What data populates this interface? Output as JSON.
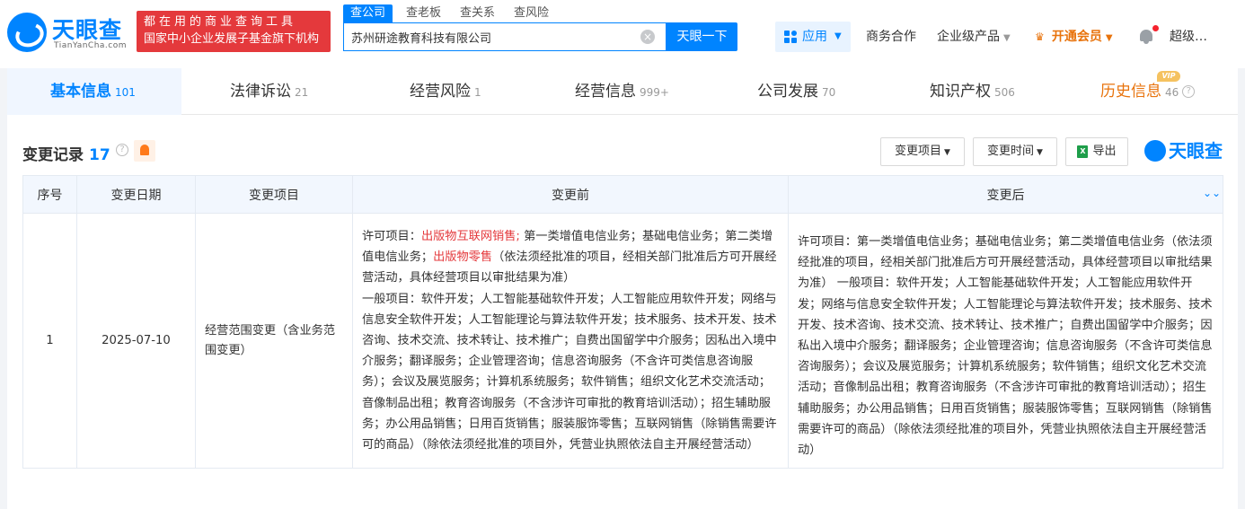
{
  "brand": {
    "logo_text": "天眼查",
    "logo_sub": "TianYanCha.com",
    "promo_line1": "都在用的商业查询工具",
    "promo_line2": "国家中小企业发展子基金旗下机构"
  },
  "search": {
    "tabs": [
      "查公司",
      "查老板",
      "查关系",
      "查风险"
    ],
    "value": "苏州研途教育科技有限公司",
    "button_label": "天眼一下"
  },
  "nav": {
    "app_label": "应用",
    "business": "商务合作",
    "enterprise": "企业级产品",
    "vip": "开通会员",
    "user": "超级…"
  },
  "main_tabs": [
    {
      "label": "基本信息",
      "count": "101"
    },
    {
      "label": "法律诉讼",
      "count": "21"
    },
    {
      "label": "经营风险",
      "count": "1"
    },
    {
      "label": "经营信息",
      "count": "999+"
    },
    {
      "label": "公司发展",
      "count": "70"
    },
    {
      "label": "知识产权",
      "count": "506"
    },
    {
      "label": "历史信息",
      "count": "46",
      "badge": "VIP"
    }
  ],
  "section": {
    "title": "变更记录",
    "count": "17",
    "filter_item": "变更项目",
    "filter_time": "变更时间",
    "export": "导出",
    "brand": "天眼查"
  },
  "table": {
    "headers": [
      "序号",
      "变更日期",
      "变更项目",
      "变更前",
      "变更后"
    ],
    "rows": [
      {
        "index": "1",
        "date": "2025-07-10",
        "item": "经营范围变更（含业务范围变更）",
        "before": {
          "p1": "许可项目：",
          "h1": "出版物互联网销售;",
          "p2": " 第一类增值电信业务；基础电信业务；第二类增值电信业务；",
          "h2": "出版物零售",
          "p3": "（依法须经批准的项目，经相关部门批准后方可开展经营活动，具体经营项目以审批结果为准）",
          "p4": "一般项目：软件开发；人工智能基础软件开发；人工智能应用软件开发；网络与信息安全软件开发；人工智能理论与算法软件开发；技术服务、技术开发、技术咨询、技术交流、技术转让、技术推广；自费出国留学中介服务；因私出入境中介服务；翻译服务；企业管理咨询；信息咨询服务（不含许可类信息咨询服务）；会议及展览服务；计算机系统服务；软件销售；组织文化艺术交流活动；音像制品出租；教育咨询服务（不含涉许可审批的教育培训活动）；招生辅助服务；办公用品销售；日用百货销售；服装服饰零售；互联网销售（除销售需要许可的商品）（除依法须经批准的项目外，凭营业执照依法自主开展经营活动）"
        },
        "after": "许可项目：第一类增值电信业务；基础电信业务；第二类增值电信业务（依法须经批准的项目，经相关部门批准后方可开展经营活动，具体经营项目以审批结果为准） 一般项目：软件开发；人工智能基础软件开发；人工智能应用软件开发；网络与信息安全软件开发；人工智能理论与算法软件开发；技术服务、技术开发、技术咨询、技术交流、技术转让、技术推广；自费出国留学中介服务；因私出入境中介服务；翻译服务；企业管理咨询；信息咨询服务（不含许可类信息咨询服务）；会议及展览服务；计算机系统服务；软件销售；组织文化艺术交流活动；音像制品出租；教育咨询服务（不含涉许可审批的教育培训活动）；招生辅助服务；办公用品销售；日用百货销售；服装服饰零售；互联网销售（除销售需要许可的商品）（除依法须经批准的项目外，凭营业执照依法自主开展经营活动）"
      }
    ]
  },
  "colors": {
    "accent": "#0084ff",
    "highlight": "#e4393c",
    "vip": "#e8730c"
  }
}
